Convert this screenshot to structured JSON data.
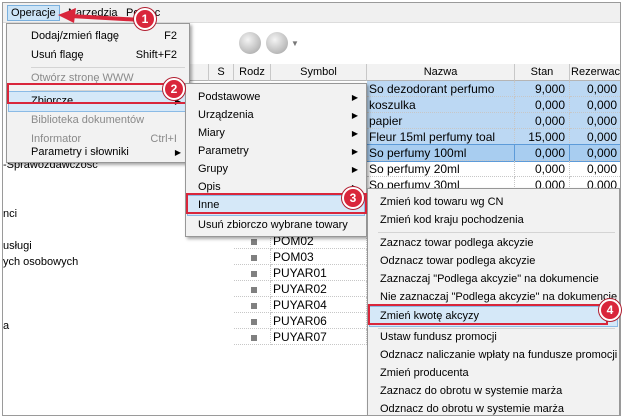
{
  "menubar": {
    "items": [
      "Operacje",
      "Narzędzia",
      "Pomoc"
    ]
  },
  "left_panel": {
    "items": [
      "-Sprawozdawczość",
      "nci",
      "usługi",
      "ych osobowych",
      "a"
    ]
  },
  "grid": {
    "columns": [
      "S",
      "Rodz",
      "Symbol",
      "Nazwa",
      "Stan",
      "Rezerwac"
    ],
    "rows": [
      {
        "nazwa": "So dezodorant perfumo",
        "stan": "9,000",
        "rez": "0,000"
      },
      {
        "nazwa": "koszulka",
        "stan": "0,000",
        "rez": "0,000"
      },
      {
        "nazwa": "papier",
        "stan": "0,000",
        "rez": "0,000"
      },
      {
        "nazwa": "Fleur 15ml perfumy toal",
        "stan": "15,000",
        "rez": "0,000"
      },
      {
        "nazwa": "So perfumy 100ml",
        "stan": "0,000",
        "rez": "0,000"
      },
      {
        "nazwa": "So perfumy 20ml",
        "stan": "0,000",
        "rez": "0,000"
      },
      {
        "nazwa": "So perfumy 30ml",
        "stan": "0,000",
        "rez": "0,000"
      }
    ],
    "symbols": [
      "POM02",
      "POM03",
      "PUYAR01",
      "PUYAR02",
      "PUYAR04",
      "PUYAR06",
      "PUYAR07"
    ]
  },
  "menu_operacje": {
    "items": [
      {
        "label": "Dodaj/zmień flagę",
        "shortcut": "F2"
      },
      {
        "label": "Usuń flagę",
        "shortcut": "Shift+F2"
      },
      {
        "label": "Otwórz stronę WWW"
      },
      {
        "label": "Zbiorcze"
      },
      {
        "label": "Biblioteka dokumentów"
      },
      {
        "label": "Informator",
        "shortcut": "Ctrl+I"
      },
      {
        "label": "Parametry i słowniki"
      }
    ]
  },
  "menu_zbiorcze": {
    "items": [
      "Podstawowe",
      "Urządzenia",
      "Miary",
      "Parametry",
      "Grupy",
      "Opis",
      "Inne",
      "Usuń zbiorczo wybrane towary"
    ]
  },
  "menu_inne": {
    "items": [
      "Zmień kod towaru wg CN",
      "Zmień kod kraju pochodzenia",
      "Zaznacz towar podlega akcyzie",
      "Odznacz towar podlega akcyzie",
      "Zaznaczaj \"Podlega akcyzie\" na dokumencie",
      "Nie zaznaczaj \"Podlega akcyzie\" na dokumencie",
      "Zmień kwotę akcyzy",
      "Ustaw fundusz promocji",
      "Odznacz naliczanie wpłaty na fundusze promocji",
      "Zmień producenta",
      "Zaznacz do obrotu w systemie marża",
      "Odznacz do obrotu w systemie marża"
    ]
  },
  "badges": [
    "1",
    "2",
    "3",
    "4"
  ],
  "colors": {
    "accent_red": "#d9263b",
    "selection": "#bcd8f3",
    "highlight": "#d5e8f8"
  }
}
